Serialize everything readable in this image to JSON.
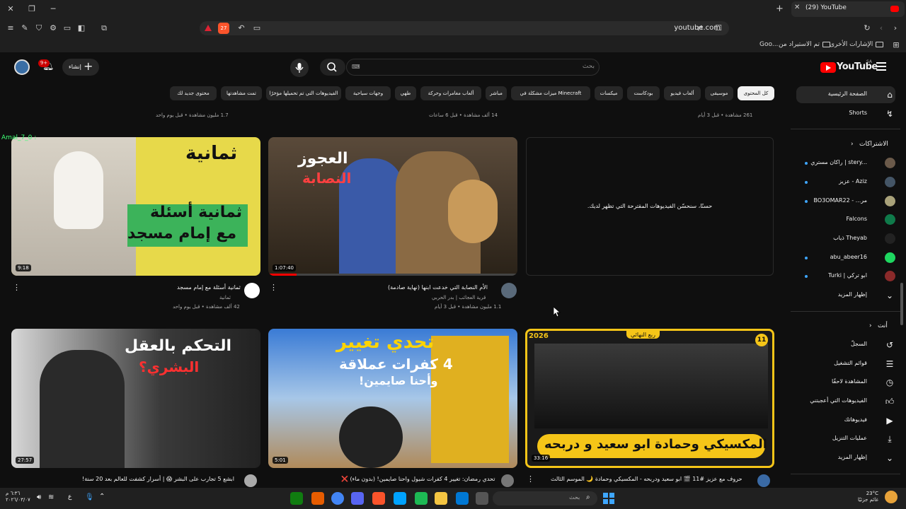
{
  "browser": {
    "tab_title": "(29) YouTube",
    "url": "youtube.com",
    "shield_count": "27",
    "bookmarks": [
      "Goo...",
      "تم الاستيراد من",
      "الإشارات الأخرى"
    ]
  },
  "youtube": {
    "logo": "YouTube",
    "logo_country": "SA",
    "search_placeholder": "بحث",
    "search_kbd": "⌨",
    "create_label": "إنشاء",
    "notif_count": "9+",
    "chips": [
      "كل المحتوى",
      "موسيقى",
      "ألعاب فيديو",
      "بودكاست",
      "ميكسات",
      "ميزات مشكلة في Minecraft",
      "مباشر",
      "ألعاب مغامرات وحركة",
      "طهي",
      "وجهات سياحية",
      "الفيديوهات التي تم تحميلها مؤخرًا",
      "تمت مشاهدتها",
      "محتوى جديد لك"
    ],
    "sidebar": {
      "home": "الصفحة الرئيسية",
      "shorts": "Shorts",
      "subs_header": "الاشتراكات",
      "subs": [
        "راكان مستري | stery...",
        "عزيز - Aziz",
        "BO3OMAR22 - ...مر",
        "Falcons",
        "ذياب Theyab",
        "abu_abeer16",
        "Turki | ابو تركي"
      ],
      "show_more": "إظهار المزيد",
      "you_header": "أنت",
      "you_items": [
        "السجلّ",
        "قوائم التشغيل",
        "المشاهدة لاحقًا",
        "الفيديوهات التي أعجبتني",
        "فيديوهاتك",
        "عمليات التنزيل",
        "إظهار المزيد"
      ]
    },
    "prev_row_meta": [
      "1.7 مليون مشاهدة • قبل يوم واحد",
      "14 ألف مشاهدة • قبل 6 ساعات",
      "261 مشاهدة • قبل 3 أيام"
    ],
    "empty_message": "حسنًا، سنحسّن الفيديوهات المقترحة التي تظهر لديك.",
    "videos_row1": [
      {
        "title": "ثمانية أسئلة مع إمام مسجد",
        "channel": "ثمانية",
        "meta": "42 ألف مشاهدة • قبل يوم واحد",
        "duration": "9:18",
        "thumb_text1": "ثمانية",
        "thumb_text2": "ثمانية أسئلة",
        "thumb_text3": "مع إمام مسجد",
        "overlay": "Amal_7_0 :"
      },
      {
        "title": "الأم النصابة التي خدعت ابنها (نهاية صادمة)",
        "channel": "قرية العجائب | بدر الحربي",
        "meta": "1.1 مليون مشاهدة • قبل 3 أيام",
        "duration": "1:07:40",
        "thumb_text1": "العجوز",
        "thumb_text2": "النصابة"
      }
    ],
    "videos_row2": [
      {
        "title": "ابشع 5 تجارب على البشر 😱 | أسرار كشفت للعالم بعد 20 سنة!",
        "duration": "27:57",
        "thumb_text1": "التحكم بالعقل",
        "thumb_text2": "البشري؟"
      },
      {
        "title": "تحدي رمضان: تغيير 4 كفرات شيول واحنا صايمين! (بدون ماء) ❌",
        "duration": "5:01",
        "thumb_text1": "تحدي تغيير",
        "thumb_text2": "4 كفرات عملاقة",
        "thumb_text3": "وأحنا صايمين!"
      },
      {
        "title": "حروف مع عزيز #11 🎬 ابو سعيد ودربحه - المكسيكي وحمادة 🌙 الموسم الثالث",
        "duration": "33:16",
        "thumb_text1": "ابو سعيد و دربحه",
        "thumb_text2": "المكسيكي وحمادة",
        "badge": "11",
        "year": "2026",
        "tag": "ربع النهائي"
      }
    ]
  },
  "taskbar": {
    "time": "٦:٣٦ م",
    "date": "٢٠٢٦/٠٣/٠٧",
    "lang": "ع",
    "temp": "23°C",
    "weather": "غائم جزئيًا",
    "search": "بحث"
  }
}
